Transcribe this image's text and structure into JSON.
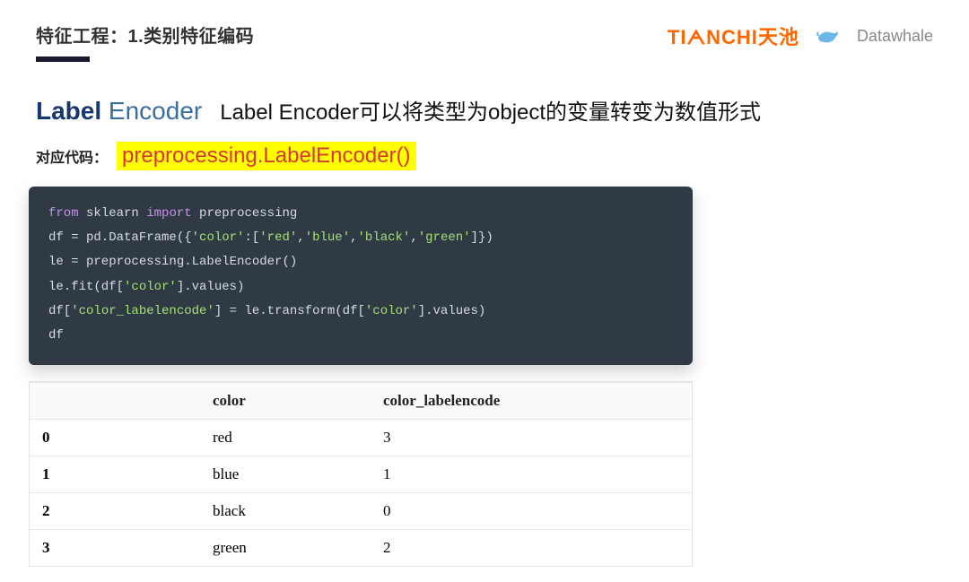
{
  "header": {
    "breadcrumb": "特征工程：1.类别特征编码",
    "tianchi_logo": "TIᗅNCHI",
    "tianchi_cn": "天池",
    "datawhale": "Datawhale"
  },
  "title": {
    "label_word": "Label",
    "encoder_word": " Encoder",
    "description": "Label Encoder可以将类型为object的变量转变为数值形式"
  },
  "code_label": {
    "prefix": "对应代码：",
    "highlight": "preprocessing.LabelEncoder()"
  },
  "code": {
    "l1_kw1": "from",
    "l1_mod": " sklearn ",
    "l1_kw2": "import",
    "l1_mod2": " preprocessing",
    "l2_a": "df = pd.DataFrame({",
    "l2_s1": "'color'",
    "l2_b": ":[",
    "l2_s2": "'red'",
    "l2_c": ",",
    "l2_s3": "'blue'",
    "l2_d": ",",
    "l2_s4": "'black'",
    "l2_e": ",",
    "l2_s5": "'green'",
    "l2_f": "]})",
    "l3": "le = preprocessing.LabelEncoder()",
    "l4_a": "le.fit(df[",
    "l4_s": "'color'",
    "l4_b": "].values)",
    "l5_a": "df[",
    "l5_s1": "'color_labelencode'",
    "l5_b": "] = le.transform(df[",
    "l5_s2": "'color'",
    "l5_c": "].values)",
    "l6": "df"
  },
  "table": {
    "headers": {
      "h0": "",
      "h1": "color",
      "h2": "color_labelencode"
    },
    "rows": [
      {
        "idx": "0",
        "color": "red",
        "enc": "3"
      },
      {
        "idx": "1",
        "color": "blue",
        "enc": "1"
      },
      {
        "idx": "2",
        "color": "black",
        "enc": "0"
      },
      {
        "idx": "3",
        "color": "green",
        "enc": "2"
      }
    ]
  }
}
